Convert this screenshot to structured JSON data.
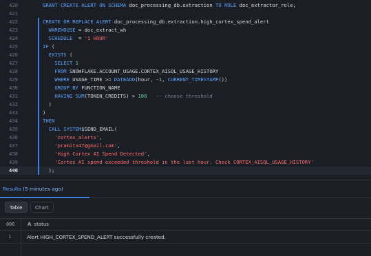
{
  "editor": {
    "active_line": "440",
    "lines": [
      {
        "n": "420",
        "parts": [
          [
            "kw",
            "GRANT CREATE ALERT ON SCHEMA "
          ],
          [
            "fn",
            "doc_processing_db.extraction "
          ],
          [
            "kw",
            "TO ROLE "
          ],
          [
            "fn",
            "doc_extractor_role;"
          ]
        ]
      },
      {
        "n": "421",
        "parts": []
      },
      {
        "n": "422",
        "parts": [
          [
            "kw",
            "CREATE OR REPLACE ALERT "
          ],
          [
            "fn",
            "doc_processing_db.extraction.high_cortex_spend_alert"
          ]
        ]
      },
      {
        "n": "423",
        "parts": [
          [
            "fn",
            "  "
          ],
          [
            "kw",
            "WAREHOUSE "
          ],
          [
            "fn",
            "= doc_extract_wh"
          ]
        ]
      },
      {
        "n": "424",
        "parts": [
          [
            "fn",
            "  "
          ],
          [
            "kw",
            "SCHEDULE  "
          ],
          [
            "fn",
            "= "
          ],
          [
            "str",
            "'1 HOUR'"
          ]
        ]
      },
      {
        "n": "425",
        "parts": [
          [
            "kw",
            "IF "
          ],
          [
            "fn",
            "("
          ]
        ]
      },
      {
        "n": "426",
        "parts": [
          [
            "fn",
            "  "
          ],
          [
            "kw",
            "EXISTS "
          ],
          [
            "fn",
            "("
          ]
        ]
      },
      {
        "n": "427",
        "parts": [
          [
            "fn",
            "    "
          ],
          [
            "kw",
            "SELECT "
          ],
          [
            "num",
            "1"
          ]
        ]
      },
      {
        "n": "428",
        "parts": [
          [
            "fn",
            "    "
          ],
          [
            "kw",
            "FROM "
          ],
          [
            "fn",
            "SNOWFLAKE.ACCOUNT_USAGE.CORTEX_AISQL_USAGE_HISTORY"
          ]
        ]
      },
      {
        "n": "429",
        "parts": [
          [
            "fn",
            "    "
          ],
          [
            "kw",
            "WHERE "
          ],
          [
            "fn",
            "USAGE_TIME >= "
          ],
          [
            "kw",
            "DATEADD"
          ],
          [
            "fn",
            "(hour, -"
          ],
          [
            "num",
            "1"
          ],
          [
            "fn",
            ", "
          ],
          [
            "kw",
            "CURRENT_TIMESTAMP"
          ],
          [
            "fn",
            "())"
          ]
        ]
      },
      {
        "n": "430",
        "parts": [
          [
            "fn",
            "    "
          ],
          [
            "kw",
            "GROUP BY "
          ],
          [
            "fn",
            "FUNCTION_NAME"
          ]
        ]
      },
      {
        "n": "431",
        "parts": [
          [
            "fn",
            "    "
          ],
          [
            "kw",
            "HAVING SUM"
          ],
          [
            "fn",
            "(TOKEN_CREDITS) > "
          ],
          [
            "num",
            "100"
          ],
          [
            "fn",
            "   "
          ],
          [
            "cmt",
            "-- choose threshold"
          ]
        ]
      },
      {
        "n": "432",
        "parts": [
          [
            "fn",
            "  )"
          ]
        ]
      },
      {
        "n": "433",
        "parts": [
          [
            "fn",
            ")"
          ]
        ]
      },
      {
        "n": "434",
        "parts": [
          [
            "kw",
            "THEN"
          ]
        ]
      },
      {
        "n": "435",
        "parts": [
          [
            "fn",
            "  "
          ],
          [
            "kw",
            "CALL SYSTEM"
          ],
          [
            "fn",
            "$SEND_EMAIL("
          ]
        ]
      },
      {
        "n": "436",
        "parts": [
          [
            "fn",
            "    "
          ],
          [
            "str",
            "'cortex_alerts'"
          ],
          [
            "fn",
            ","
          ]
        ]
      },
      {
        "n": "437",
        "parts": [
          [
            "fn",
            "    "
          ],
          [
            "str",
            "'pramitx47@gmail.com'"
          ],
          [
            "fn",
            ","
          ]
        ]
      },
      {
        "n": "438",
        "parts": [
          [
            "fn",
            "    "
          ],
          [
            "str",
            "'High Cortex AI Spend Detected'"
          ],
          [
            "fn",
            ","
          ]
        ]
      },
      {
        "n": "439",
        "parts": [
          [
            "fn",
            "    "
          ],
          [
            "str",
            "'Cortex AI spend exceeded threshold in the last hour. Check CORTEX_AISQL_USAGE_HISTORY'"
          ]
        ]
      },
      {
        "n": "440",
        "parts": [
          [
            "fn",
            "  );"
          ]
        ]
      }
    ]
  },
  "results": {
    "title": "Results",
    "time": "(5 minutes ago)",
    "tabs": {
      "table": "Table",
      "chart": "Chart"
    },
    "index_header": "000",
    "column_header": "status",
    "rows": [
      {
        "idx": "1",
        "status": "Alert HIGH_CORTEX_SPEND_ALERT successfully created."
      }
    ]
  },
  "colors": {
    "keyword": "#5ea4ff",
    "string": "#ff6f6f",
    "number": "#6fd79a",
    "comment": "#7b838e",
    "accent": "#3f7fe0",
    "background": "#1b1e24"
  }
}
